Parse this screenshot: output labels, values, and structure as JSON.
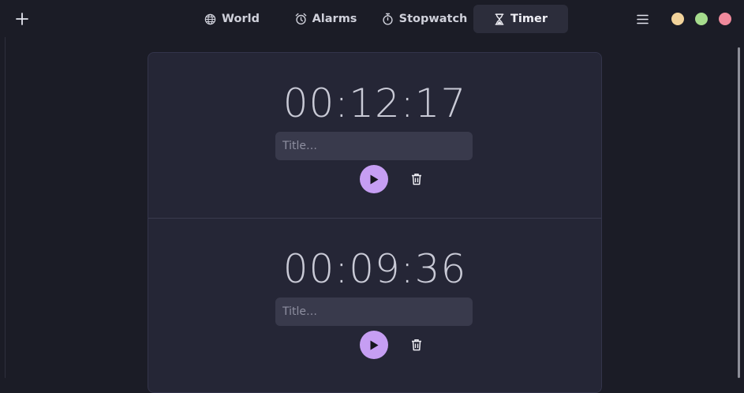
{
  "header": {
    "tabs": [
      {
        "label": "World",
        "icon": "globe-icon",
        "active": false
      },
      {
        "label": "Alarms",
        "icon": "alarm-clock-icon",
        "active": false
      },
      {
        "label": "Stopwatch",
        "icon": "stopwatch-icon",
        "active": false
      },
      {
        "label": "Timer",
        "icon": "hourglass-icon",
        "active": true
      }
    ],
    "add_icon": "plus-icon",
    "menu_icon": "hamburger-menu-icon",
    "window_buttons": [
      {
        "name": "minimize",
        "color": "#f2d39b"
      },
      {
        "name": "maximize",
        "color": "#a6dc8d"
      },
      {
        "name": "close",
        "color": "#f08a9c"
      }
    ]
  },
  "timers": [
    {
      "time": "00:12:17",
      "title_value": "",
      "title_placeholder": "Title…"
    },
    {
      "time": "00:09:36",
      "title_value": "",
      "title_placeholder": "Title…"
    }
  ],
  "colors": {
    "accent": "#c69ef3",
    "background": "#1b1c26",
    "card": "#252636",
    "active_tab": "#2c2d3b"
  }
}
